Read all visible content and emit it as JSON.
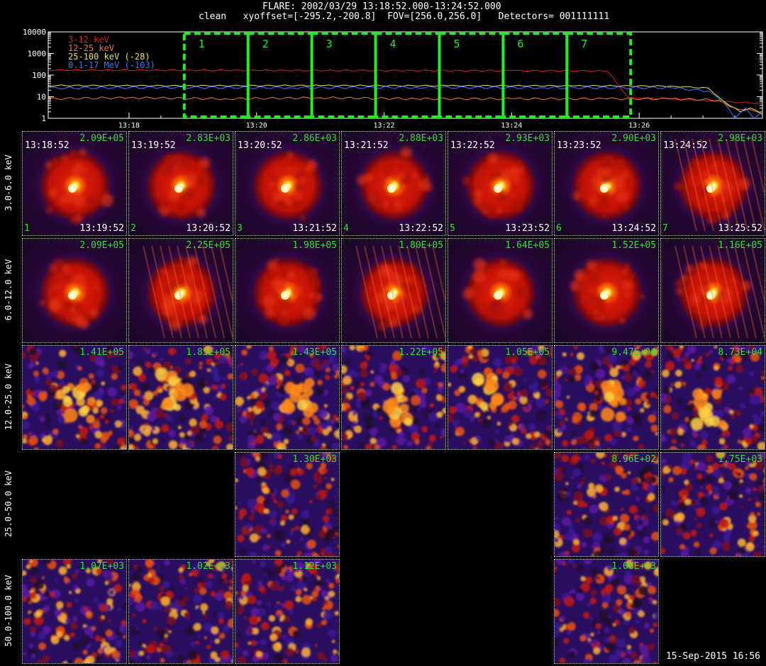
{
  "header": {
    "line1": "FLARE: 2002/03/29 13:18:52.000-13:24:52.000",
    "line2": "clean   xyoffset=[-295.2,-200.8]  FOV=[256.0,256.0]   Detectors= 001111111"
  },
  "chart_data": [
    {
      "type": "line",
      "yscale": "log",
      "ylim": [
        1,
        10000
      ],
      "ytick_labels": [
        "1",
        "10",
        "100",
        "1000",
        "10000"
      ],
      "x_range": [
        "13:16:44",
        "13:27:56"
      ],
      "xtick_labels": [
        "13:18",
        "13:20",
        "13:22",
        "13:24",
        "13:26"
      ],
      "legend": [
        "3-12 keV",
        "12-25 keV",
        "25-100 keV (-28)",
        "0.1-17 MeV (-103)"
      ],
      "series": [
        {
          "name": "3-12 keV",
          "color": "#e01e1e",
          "x": [
            "13:16:44",
            "13:20:00",
            "13:24:00",
            "13:25:30",
            "13:25:50",
            "13:26:30",
            "13:27:00",
            "13:27:15",
            "13:27:56"
          ],
          "y": [
            170,
            165,
            160,
            155,
            9,
            8,
            7,
            6,
            5
          ]
        },
        {
          "name": "12-25 keV",
          "color": "#f07828",
          "x": [
            "13:16:44",
            "13:18:00",
            "13:19:30",
            "13:21:00",
            "13:22:30",
            "13:24:00",
            "13:25:30",
            "13:26:30",
            "13:27:15",
            "13:27:30",
            "13:27:56"
          ],
          "y": [
            8,
            9,
            8,
            9,
            8,
            8,
            8,
            8,
            7,
            3,
            2
          ]
        },
        {
          "name": "25-100 keV (-28)",
          "color": "#f0e040",
          "x": [
            "13:16:44",
            "13:19:00",
            "13:21:00",
            "13:23:00",
            "13:25:00",
            "13:26:30",
            "13:27:05",
            "13:27:20",
            "13:27:35",
            "13:27:45",
            "13:27:56"
          ],
          "y": [
            33,
            32,
            33,
            32,
            32,
            31,
            25,
            6,
            2,
            3,
            1.5
          ]
        },
        {
          "name": "0.1-17 MeV (-103)",
          "color": "#3b78ff",
          "x": [
            "13:16:44",
            "13:18:30",
            "13:20:30",
            "13:22:30",
            "13:24:30",
            "13:26:30",
            "13:27:05",
            "13:27:20",
            "13:27:30",
            "13:27:40",
            "13:27:48",
            "13:27:56"
          ],
          "y": [
            25,
            27,
            26,
            27,
            26,
            26,
            18,
            5,
            1,
            3,
            1,
            2
          ]
        }
      ],
      "intervals": [
        {
          "label": "1",
          "start": "13:18:52",
          "end": "13:19:52"
        },
        {
          "label": "2",
          "start": "13:19:52",
          "end": "13:20:52"
        },
        {
          "label": "3",
          "start": "13:20:52",
          "end": "13:21:52"
        },
        {
          "label": "4",
          "start": "13:21:52",
          "end": "13:22:52"
        },
        {
          "label": "5",
          "start": "13:22:52",
          "end": "13:23:52"
        },
        {
          "label": "6",
          "start": "13:23:52",
          "end": "13:24:52"
        },
        {
          "label": "7",
          "start": "13:24:52",
          "end": "13:25:52"
        }
      ],
      "interval_color": "#22ee22"
    },
    {
      "type": "heatmap",
      "colormap": "hot",
      "rows": [
        "3.0-6.0 keV",
        "6.0-12.0 keV",
        "12.0-25.0 keV",
        "25.0-50.0 keV",
        "50.0-100.0 keV"
      ],
      "columns": [
        {
          "index": "1",
          "start": "13:18:52",
          "end": "13:19:52"
        },
        {
          "index": "2",
          "start": "13:19:52",
          "end": "13:20:52"
        },
        {
          "index": "3",
          "start": "13:20:52",
          "end": "13:21:52"
        },
        {
          "index": "4",
          "start": "13:21:52",
          "end": "13:22:52"
        },
        {
          "index": "5",
          "start": "13:22:52",
          "end": "13:23:52"
        },
        {
          "index": "6",
          "start": "13:23:52",
          "end": "13:24:52"
        },
        {
          "index": "7",
          "start": "13:24:52",
          "end": "13:25:52"
        }
      ],
      "peaks": [
        [
          "2.09E+05",
          "2.83E+03",
          "2.86E+03",
          "2.88E+03",
          "2.93E+03",
          "2.90E+03",
          "2.98E+03"
        ],
        [
          "2.09E+05",
          "2.25E+05",
          "1.98E+05",
          "1.80E+05",
          "1.64E+05",
          "1.52E+05",
          "1.16E+05"
        ],
        [
          "1.41E+05",
          "1.85E+05",
          "1.43E+05",
          "1.22E+05",
          "1.05E+05",
          "9.47E+04",
          "8.73E+04"
        ],
        [
          "",
          "",
          "1.30E+03",
          "",
          "",
          "8.96E+02",
          "1.75E+03"
        ],
        [
          "1.07E+03",
          "1.02E+03",
          "1.12E+03",
          "",
          "",
          "1.08E+03",
          ""
        ]
      ],
      "image_kind": [
        [
          "ring",
          "ring",
          "ring",
          "ring",
          "ring",
          "ring",
          "streak"
        ],
        [
          "ring",
          "streak",
          "ring",
          "streak",
          "ring",
          "ring",
          "streak"
        ],
        [
          "noise-blob",
          "noise-blob",
          "noise-blob",
          "noise-blob",
          "noise-blob",
          "noise-blob",
          "noise-blob"
        ],
        [
          "none",
          "none",
          "noise",
          "none",
          "none",
          "noise",
          "noise"
        ],
        [
          "noise",
          "noise",
          "noise",
          "none",
          "none",
          "noise",
          "none"
        ]
      ]
    }
  ],
  "footer": {
    "date": "15-Sep-2015 16:56"
  }
}
